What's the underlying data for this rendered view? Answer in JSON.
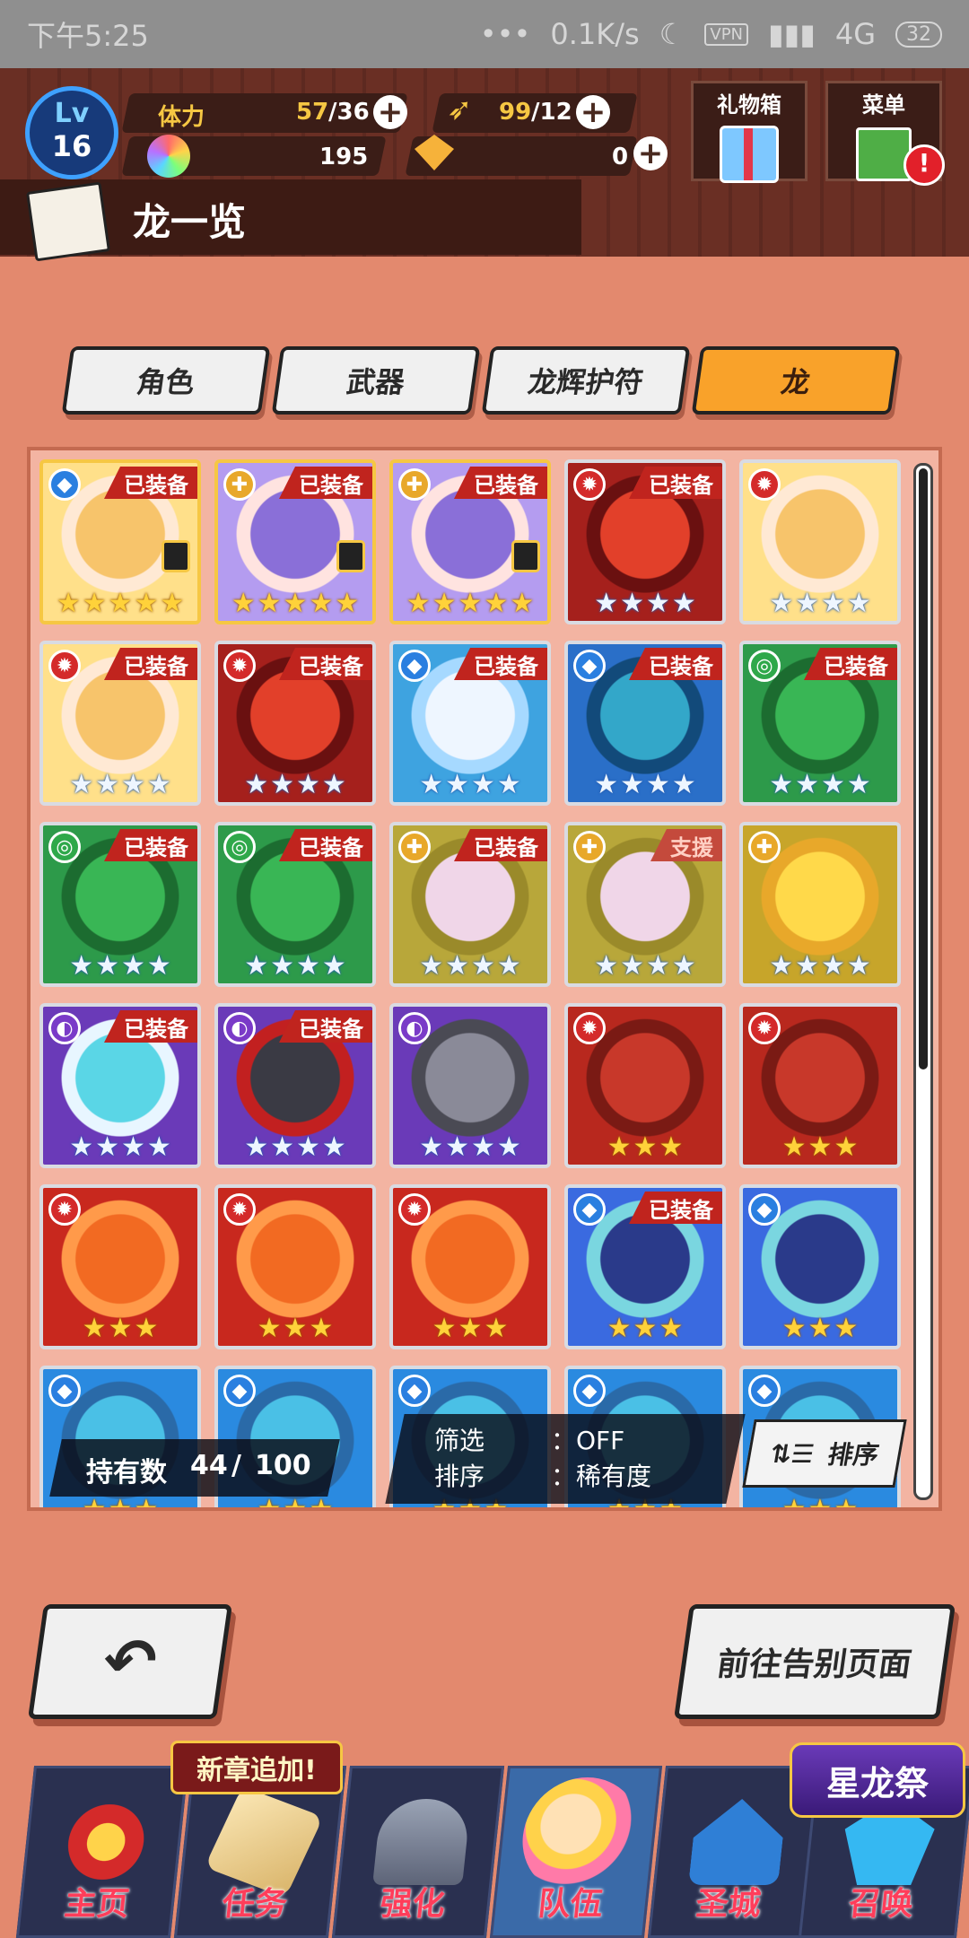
{
  "status_bar": {
    "time": "下午5:25",
    "dots": "•••",
    "speed": "0.1K/s",
    "vpn": "VPN",
    "network": "4G",
    "battery": "32"
  },
  "header": {
    "level_label": "Lv",
    "level": "16",
    "stamina_label": "体力",
    "stamina_value": "57",
    "stamina_max": "/36",
    "wings_value": "99",
    "wings_max": "/12",
    "gems_value": "195",
    "crystal_value": "0",
    "gift_box_label": "礼物箱",
    "menu_label": "菜单",
    "page_title": "龙一览"
  },
  "tabs": [
    {
      "label": "角色",
      "active": false
    },
    {
      "label": "武器",
      "active": false
    },
    {
      "label": "龙辉护符",
      "active": false
    },
    {
      "label": "龙",
      "active": true
    }
  ],
  "grid": {
    "cards": [
      {
        "element": "water",
        "badge": "已装备",
        "stars": 5,
        "star_color": "gold",
        "locked": true,
        "frame": "gold",
        "art": "blonde-girl"
      },
      {
        "element": "light",
        "badge": "已装备",
        "stars": 5,
        "star_color": "gold",
        "locked": true,
        "frame": "gold",
        "art": "purple-girl"
      },
      {
        "element": "light",
        "badge": "已装备",
        "stars": 5,
        "star_color": "gold",
        "locked": true,
        "frame": "gold",
        "art": "purple-girl"
      },
      {
        "element": "fire",
        "badge": "已装备",
        "stars": 4,
        "star_color": "silver",
        "locked": false,
        "frame": "silver",
        "art": "red-dragon"
      },
      {
        "element": "fire",
        "badge": "",
        "stars": 4,
        "star_color": "silver",
        "locked": false,
        "frame": "silver",
        "art": "blonde-girl"
      },
      {
        "element": "fire",
        "badge": "已装备",
        "stars": 4,
        "star_color": "silver",
        "locked": false,
        "frame": "silver",
        "art": "blonde-girl"
      },
      {
        "element": "fire",
        "badge": "已装备",
        "stars": 4,
        "star_color": "silver",
        "locked": false,
        "frame": "silver",
        "art": "red-dragon"
      },
      {
        "element": "water",
        "badge": "已装备",
        "stars": 4,
        "star_color": "silver",
        "locked": false,
        "frame": "silver",
        "art": "white-dragon"
      },
      {
        "element": "water",
        "badge": "已装备",
        "stars": 4,
        "star_color": "silver",
        "locked": false,
        "frame": "silver",
        "art": "blue-dragon"
      },
      {
        "element": "wind",
        "badge": "已装备",
        "stars": 4,
        "star_color": "silver",
        "locked": false,
        "frame": "silver",
        "art": "green-dragon"
      },
      {
        "element": "wind",
        "badge": "已装备",
        "stars": 4,
        "star_color": "silver",
        "locked": false,
        "frame": "silver",
        "art": "green-dragon"
      },
      {
        "element": "wind",
        "badge": "已装备",
        "stars": 4,
        "star_color": "silver",
        "locked": false,
        "frame": "silver",
        "art": "green-dragon"
      },
      {
        "element": "light",
        "badge": "已装备",
        "stars": 4,
        "star_color": "silver",
        "locked": false,
        "frame": "silver",
        "art": "pink-dragon"
      },
      {
        "element": "light",
        "badge": "支援",
        "stars": 4,
        "star_color": "silver",
        "locked": false,
        "frame": "silver",
        "art": "pink-dragon"
      },
      {
        "element": "light",
        "badge": "",
        "stars": 4,
        "star_color": "silver",
        "locked": false,
        "frame": "silver",
        "art": "gold-dragon"
      },
      {
        "element": "shadow",
        "badge": "已装备",
        "stars": 4,
        "star_color": "silver",
        "locked": false,
        "frame": "silver",
        "art": "teal-girl"
      },
      {
        "element": "shadow",
        "badge": "已装备",
        "stars": 4,
        "star_color": "silver",
        "locked": false,
        "frame": "silver",
        "art": "dark-dragon"
      },
      {
        "element": "shadow",
        "badge": "",
        "stars": 4,
        "star_color": "silver",
        "locked": false,
        "frame": "silver",
        "art": "grey-dragon"
      },
      {
        "element": "fire",
        "badge": "",
        "stars": 3,
        "star_color": "gold",
        "locked": false,
        "frame": "silver",
        "art": "crimson-dragon"
      },
      {
        "element": "fire",
        "badge": "",
        "stars": 3,
        "star_color": "gold",
        "locked": false,
        "frame": "silver",
        "art": "crimson-dragon"
      },
      {
        "element": "fire",
        "badge": "",
        "stars": 3,
        "star_color": "gold",
        "locked": false,
        "frame": "silver",
        "art": "orange-dragon"
      },
      {
        "element": "fire",
        "badge": "",
        "stars": 3,
        "star_color": "gold",
        "locked": false,
        "frame": "silver",
        "art": "orange-dragon"
      },
      {
        "element": "fire",
        "badge": "",
        "stars": 3,
        "star_color": "gold",
        "locked": false,
        "frame": "silver",
        "art": "orange-dragon"
      },
      {
        "element": "water",
        "badge": "已装备",
        "stars": 3,
        "star_color": "gold",
        "locked": false,
        "frame": "silver",
        "art": "navy-dragon"
      },
      {
        "element": "water",
        "badge": "",
        "stars": 3,
        "star_color": "gold",
        "locked": false,
        "frame": "silver",
        "art": "navy-dragon"
      },
      {
        "element": "water",
        "badge": "",
        "stars": 3,
        "star_color": "gold",
        "locked": false,
        "frame": "silver",
        "art": "cyan-dragon"
      },
      {
        "element": "water",
        "badge": "",
        "stars": 3,
        "star_color": "gold",
        "locked": false,
        "frame": "silver",
        "art": "cyan-dragon"
      },
      {
        "element": "water",
        "badge": "",
        "stars": 3,
        "star_color": "gold",
        "locked": false,
        "frame": "silver",
        "art": "cyan-dragon"
      },
      {
        "element": "water",
        "badge": "",
        "stars": 3,
        "star_color": "gold",
        "locked": false,
        "frame": "silver",
        "art": "cyan-dragon"
      },
      {
        "element": "water",
        "badge": "",
        "stars": 3,
        "star_color": "gold",
        "locked": false,
        "frame": "silver",
        "art": "cyan-dragon"
      }
    ]
  },
  "owned": {
    "label": "持有数",
    "count": "44",
    "max": "100"
  },
  "filter": {
    "filter_label": "筛选",
    "filter_value": "：OFF",
    "sort_label": "排序",
    "sort_value": "：稀有度"
  },
  "sort_button_label": "排序",
  "back_button_icon": "back-arrow-icon",
  "farewell_button_label": "前往告别页面",
  "new_chapter_banner": "新章追加!",
  "event_banner": "星龙祭",
  "nav": [
    {
      "label": "主页",
      "icon": "home-icon"
    },
    {
      "label": "任务",
      "icon": "quest-icon"
    },
    {
      "label": "强化",
      "icon": "upgrade-icon"
    },
    {
      "label": "队伍",
      "icon": "team-icon"
    },
    {
      "label": "圣城",
      "icon": "castle-icon"
    },
    {
      "label": "召唤",
      "icon": "summon-icon"
    }
  ],
  "colors": {
    "background": "#e3896e",
    "header": "#6a2f24",
    "active_tab": "#f9a22a",
    "badge_red": "#c0241e",
    "nav_label": "#ff3d5a"
  }
}
